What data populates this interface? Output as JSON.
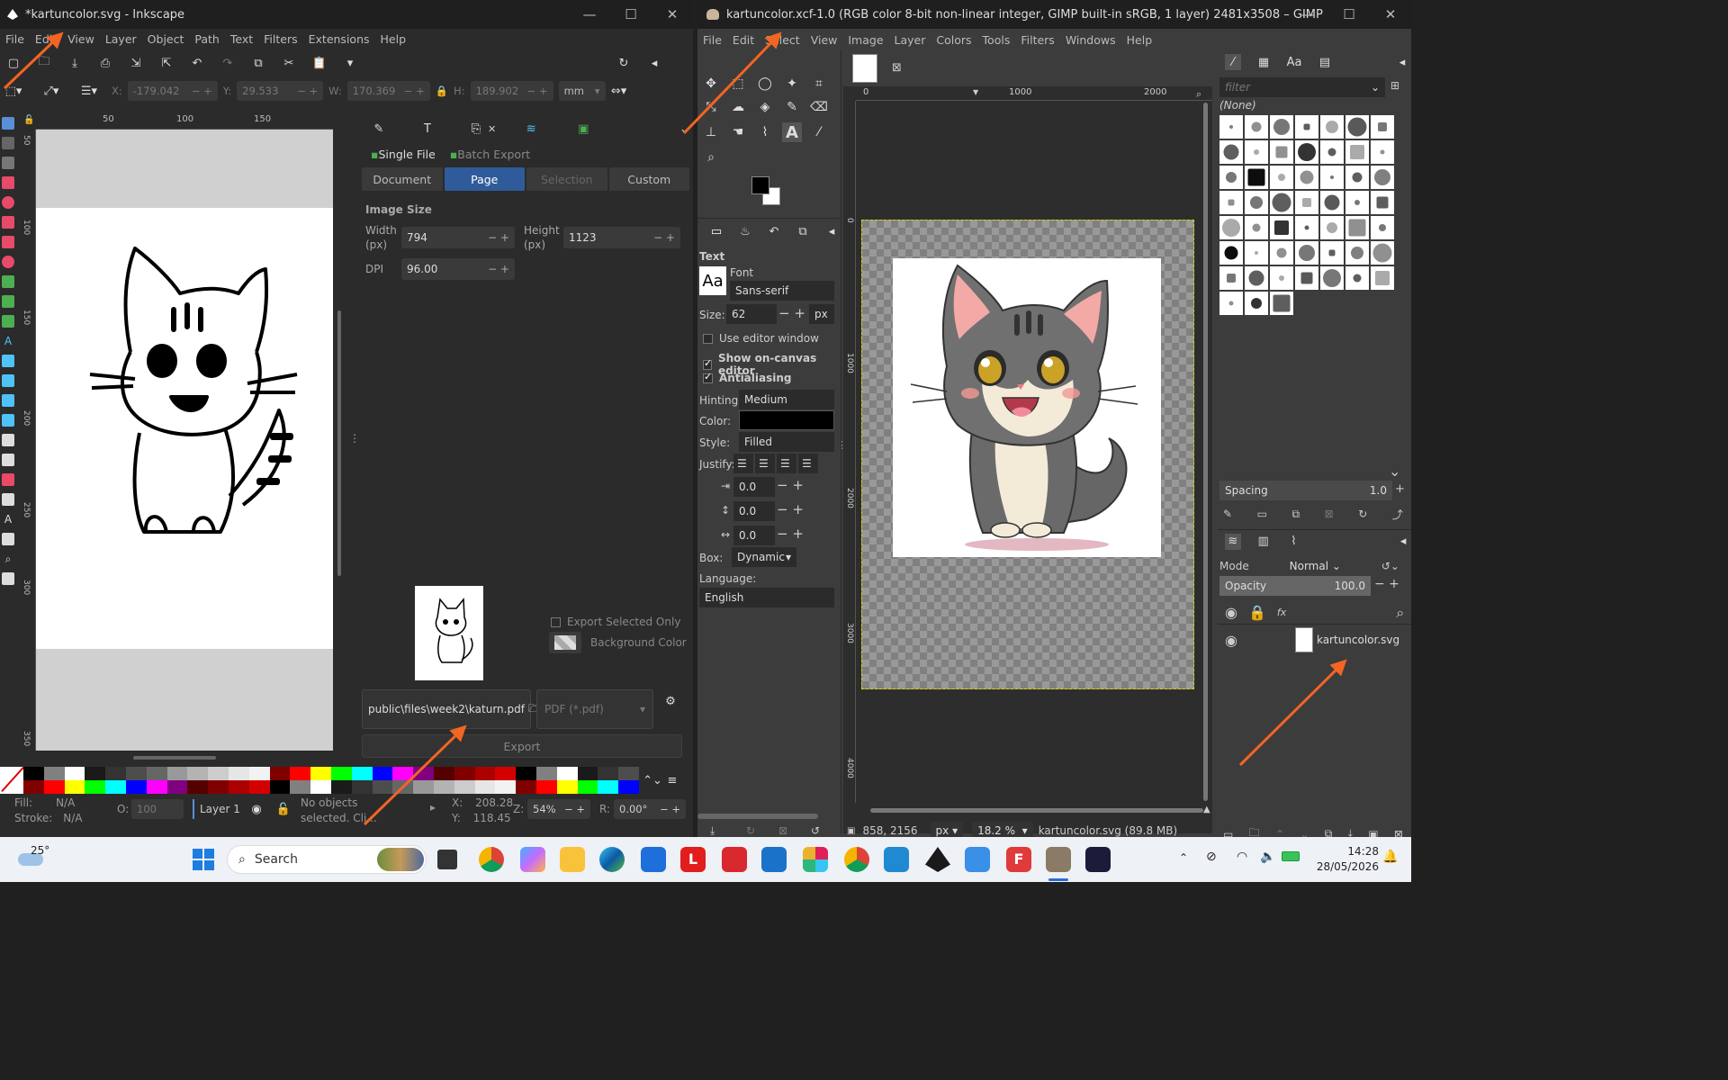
{
  "inkscape": {
    "title": "*kartuncolor.svg - Inkscape",
    "menu": [
      "File",
      "Edit",
      "View",
      "Layer",
      "Object",
      "Path",
      "Text",
      "Filters",
      "Extensions",
      "Help"
    ],
    "ctrl": {
      "x_label": "X:",
      "x": "-179.042",
      "y_label": "Y:",
      "y": "29.533",
      "w_label": "W:",
      "w": "170.369",
      "h_label": "H:",
      "h": "189.902",
      "unit": "mm"
    },
    "ruler_h": [
      "50",
      "100",
      "150"
    ],
    "ruler_v": [
      "50",
      "100",
      "150",
      "200",
      "250",
      "300",
      "350"
    ],
    "export": {
      "mode_single": "Single File",
      "mode_batch": "Batch Export",
      "areas": [
        "Document",
        "Page",
        "Selection",
        "Custom"
      ],
      "image_size": "Image Size",
      "width_label": "Width",
      "width_unit": "(px)",
      "width": "794",
      "height_label": "Height",
      "height_unit": "(px)",
      "height": "1123",
      "dpi_label": "DPI",
      "dpi": "96.00",
      "export_selected_only": "Export Selected Only",
      "background_color": "Background Color",
      "filename": "public\\files\\week2\\katurn.pdf",
      "format": "PDF (*.pdf)",
      "export_button": "Export"
    },
    "status": {
      "fill_label": "Fill:",
      "fill": "N/A",
      "stroke_label": "Stroke:",
      "stroke": "N/A",
      "opacity_label": "O:",
      "opacity": "100",
      "layer": "Layer 1",
      "message": "No objects selected. Cli...",
      "x_label": "X:",
      "x": "208.28",
      "y_label": "Y:",
      "y": "118.45",
      "zoom_label": "Z:",
      "zoom": "54%",
      "rot_label": "R:",
      "rotation": "0.00°"
    },
    "palette": [
      "#000000",
      "#808080",
      "#ffffff",
      "#1a1a1a",
      "#333333",
      "#4d4d4d",
      "#666666",
      "#999999",
      "#b3b3b3",
      "#cccccc",
      "#e6e6e6",
      "#f2f2f2",
      "#800000",
      "#ff0000",
      "#ffff00",
      "#00ff00",
      "#00ffff",
      "#0000ff",
      "#ff00ff",
      "#800080",
      "#550000",
      "#800000",
      "#aa0000",
      "#d40000"
    ]
  },
  "gimp": {
    "title": "kartuncolor.xcf-1.0 (RGB color 8-bit non-linear integer, GIMP built-in sRGB, 1 layer) 2481x3508 – GIMP",
    "menu": [
      "File",
      "Edit",
      "Select",
      "View",
      "Image",
      "Layer",
      "Colors",
      "Tools",
      "Filters",
      "Windows",
      "Help"
    ],
    "ruler_h": [
      "0",
      "1000",
      "2000"
    ],
    "ruler_v": [
      "0",
      "1000",
      "2000",
      "3000",
      "4000"
    ],
    "text_options": {
      "heading": "Text",
      "font_label": "Font",
      "font_preview": "Aa",
      "font": "Sans-serif",
      "size_label": "Size:",
      "size": "62",
      "size_unit": "px",
      "use_editor": "Use editor window",
      "show_onc": "Show on-canvas editor",
      "antialias": "Antialiasing",
      "hinting_label": "Hinting:",
      "hinting": "Medium",
      "color_label": "Color:",
      "style_label": "Style:",
      "style": "Filled",
      "justify_label": "Justify:",
      "indent": "0.0",
      "line_spacing": "0.0",
      "letter_spacing": "0.0",
      "box_label": "Box:",
      "box": "Dynamic",
      "language_label": "Language:",
      "language": "English"
    },
    "brushes": {
      "filter_placeholder": "filter",
      "selected": "(None)",
      "spacing_label": "Spacing",
      "spacing": "1.0"
    },
    "layers": {
      "mode_label": "Mode",
      "mode": "Normal",
      "opacity_label": "Opacity",
      "opacity": "100.0",
      "layer_name": "kartuncolor.svg"
    },
    "status": {
      "coords": "858, 2156",
      "unit": "px",
      "zoom": "18.2 %",
      "info": "kartuncolor.svg (89.8 MB)"
    }
  },
  "taskbar": {
    "weather_temp": "25°",
    "search": "Search",
    "time": "14:28",
    "date": "28/05/2026"
  }
}
